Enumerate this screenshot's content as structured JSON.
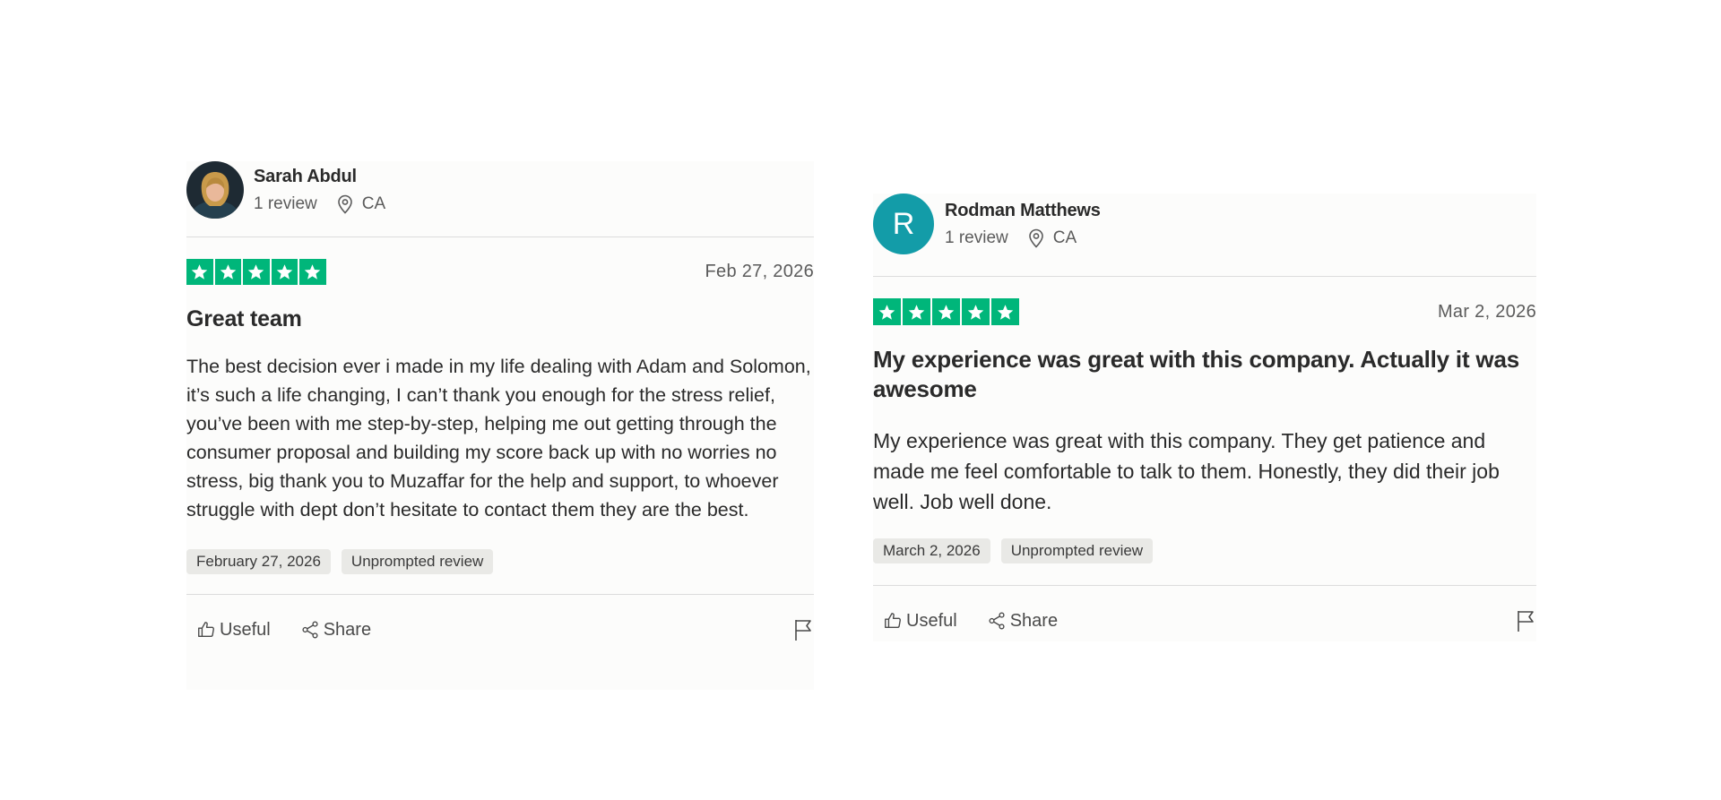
{
  "reviews": [
    {
      "reviewer": {
        "name": "Sarah Abdul",
        "review_count": "1 review",
        "location": "CA",
        "avatar": "photo"
      },
      "stars": 5,
      "date": "Feb 27, 2026",
      "title": "Great team",
      "body": "The best decision ever i made in my life dealing with Adam and Solomon, it’s such a life changing, I can’t thank you enough for the stress relief, you’ve been with me step-by-step, helping me out getting through the consumer proposal and building my score back up with no worries no stress, big thank you to Muzaffar for the help and support, to whoever struggle with dept don’t hesitate to contact them they are the best.",
      "tags": [
        "February 27, 2026",
        "Unprompted review"
      ],
      "actions": {
        "useful": "Useful",
        "share": "Share"
      }
    },
    {
      "reviewer": {
        "name": "Rodman Matthews",
        "review_count": "1 review",
        "location": "CA",
        "avatar_letter": "R"
      },
      "stars": 5,
      "date": "Mar 2, 2026",
      "title": "My experience was great with this company. Actually it was awesome",
      "body": "My experience was great with this company.  They get patience and made me feel comfortable to talk to them. Honestly,  they did their job well.  Job well done.",
      "tags": [
        "March 2, 2026",
        "Unprompted review"
      ],
      "actions": {
        "useful": "Useful",
        "share": "Share"
      }
    }
  ],
  "colors": {
    "star_green": "#00b67a",
    "avatar_teal": "#139ca8",
    "tag_bg": "#e9e9e6"
  },
  "icons": [
    "location-pin-icon",
    "star-icon",
    "thumbs-up-icon",
    "share-icon",
    "flag-icon"
  ]
}
